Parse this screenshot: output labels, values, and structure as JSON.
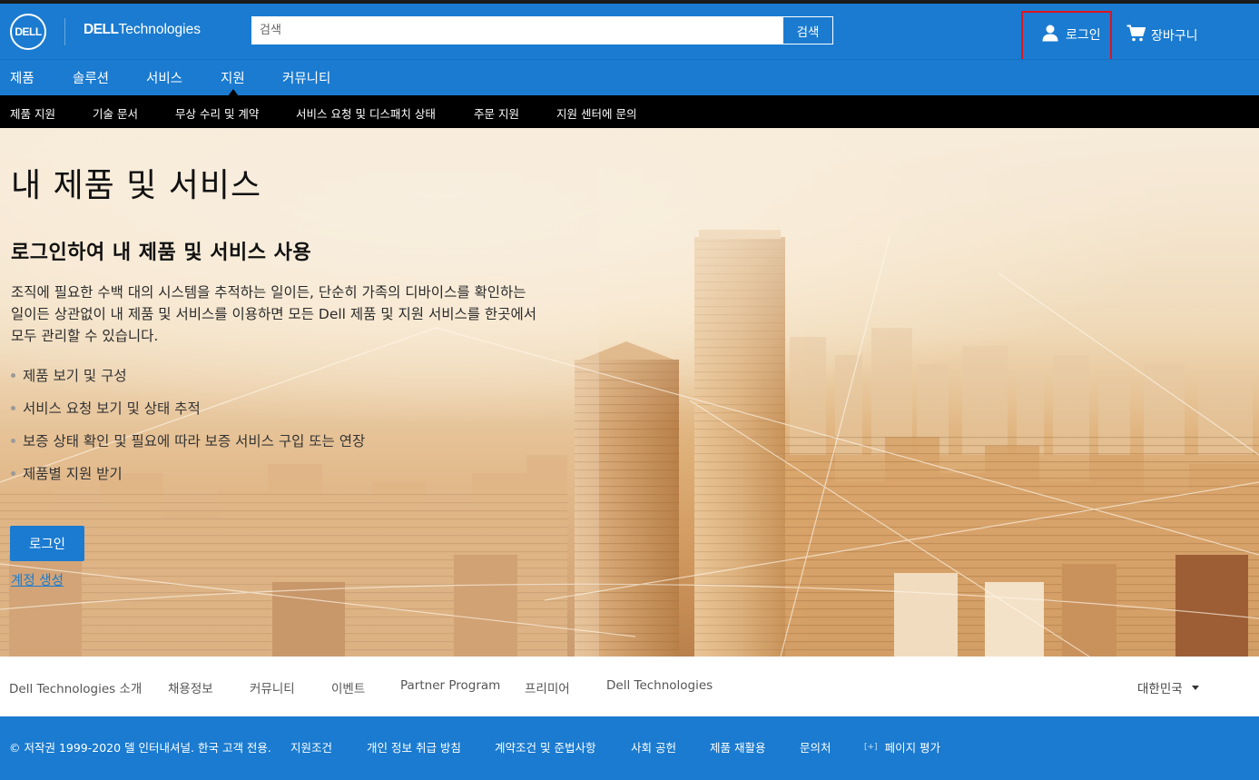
{
  "header": {
    "logo_text": "DELL",
    "brand_bold": "DELL",
    "brand_light": "Technologies",
    "search_placeholder": "검색",
    "search_button": "검색",
    "login_label": "로그인",
    "cart_label": "장바구니"
  },
  "primary_nav": {
    "items": [
      "제품",
      "솔루션",
      "서비스",
      "지원",
      "커뮤니티"
    ],
    "active": "지원"
  },
  "secondary_nav": {
    "items": [
      "제품 지원",
      "기술 문서",
      "무상 수리 및 계약",
      "서비스 요청 및 디스패치 상태",
      "주문 지원",
      "지원 센터에 문의"
    ]
  },
  "hero": {
    "title": "내 제품 및 서비스",
    "subtitle": "로그인하여 내 제품 및 서비스 사용",
    "description_lines": [
      "조직에 필요한 수백 대의 시스템을 추적하는 일이든, 단순히 가족의 디바이스를 확인하는",
      "일이든 상관없이 내 제품 및 서비스를 이용하면 모든 Dell 제품 및 지원 서비스를 한곳에서",
      "모두 관리할 수 있습니다."
    ],
    "features": [
      "제품 보기 및 구성",
      "서비스 요청 보기 및 상태 추적",
      "보증 상태 확인 및 필요에 따라 보증 서비스 구입 또는 연장",
      "제품별 지원 받기"
    ],
    "login_button": "로그인",
    "create_account": "계정 생성"
  },
  "footer": {
    "links": [
      "Dell Technologies 소개",
      "채용정보",
      "커뮤니티",
      "이벤트",
      "Partner Program",
      "프리미어",
      "Dell Technologies"
    ],
    "region": "대한민국"
  },
  "bottom_bar": {
    "copyright": "© 저작권 1999-2020 델 인터내셔널. 한국 고객 전용.",
    "links": [
      "지원조건",
      "개인 정보 취급 방침",
      "계약조건 및 준법사항",
      "사회 공헌",
      "제품 재활용",
      "문의처"
    ],
    "feedback": "페이지 평가",
    "feedback_icon": "[+]"
  },
  "colors": {
    "brand_blue": "#1a7bd0",
    "secondary_nav_bg": "#000000",
    "highlight_red": "#e0141e"
  }
}
